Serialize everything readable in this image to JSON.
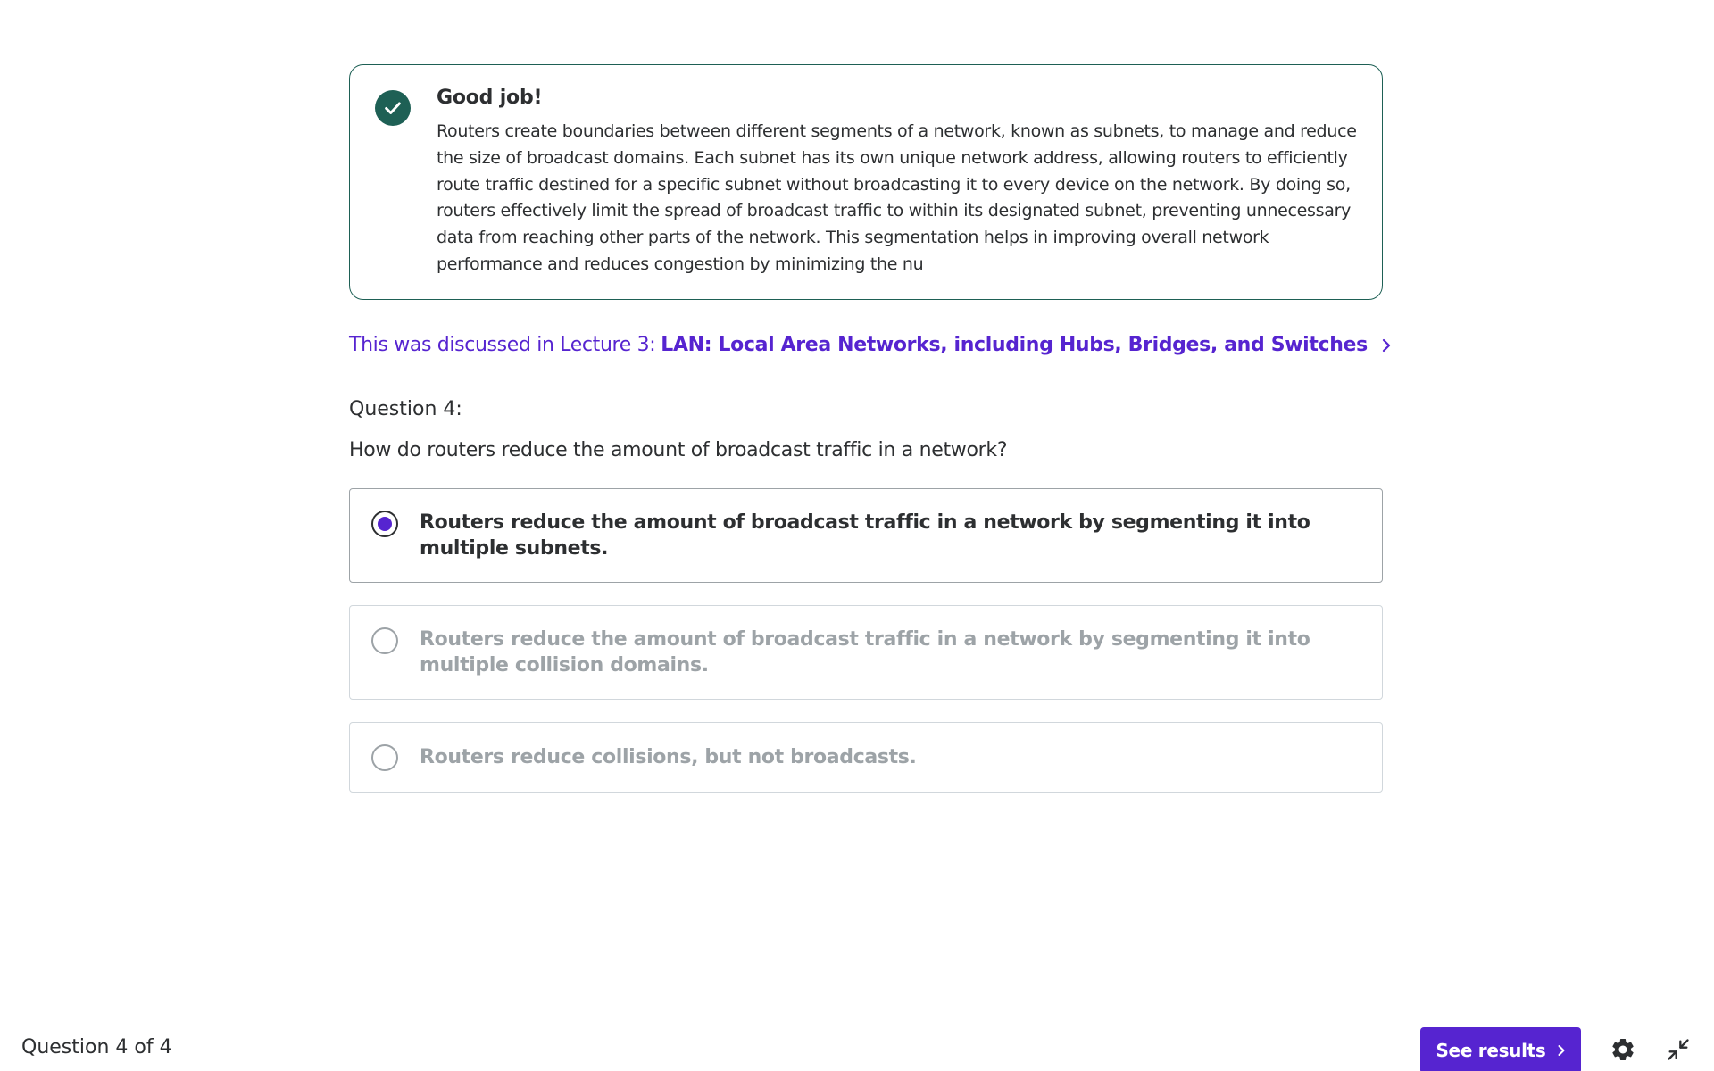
{
  "feedback": {
    "title": "Good job!",
    "body": "Routers create boundaries between different segments of a network, known as subnets, to manage and reduce the size of broadcast domains. Each subnet has its own unique network address, allowing routers to efficiently route traffic destined for a specific subnet without broadcasting it to every device on the network. By doing so, routers effectively limit the spread of broadcast traffic to within its designated subnet, preventing unnecessary data from reaching other parts of the network. This segmentation helps in improving overall network performance and reduces congestion by minimizing the nu",
    "icon": "check-circle-icon",
    "color": "#1e6055"
  },
  "lecture": {
    "prefix": "This was discussed in Lecture 3:",
    "link_text": "LAN: Local Area Networks, including Hubs, Bridges, and Switches",
    "icon": "chevron-right-icon",
    "color": "#5624d0"
  },
  "question": {
    "label": "Question 4:",
    "text": "How do routers reduce the amount of broadcast traffic in a network?"
  },
  "options": [
    {
      "text": "Routers reduce the amount of broadcast traffic in a network by segmenting it into multiple subnets.",
      "selected": true
    },
    {
      "text": "Routers reduce the amount of broadcast traffic in a network by segmenting it into multiple collision domains.",
      "selected": false
    },
    {
      "text": "Routers reduce collisions, but not broadcasts.",
      "selected": false
    }
  ],
  "footer": {
    "progress": "Question 4 of 4",
    "see_results_label": "See results",
    "settings_icon": "gear-icon",
    "collapse_icon": "collapse-icon"
  },
  "colors": {
    "accent": "#5624d0",
    "success": "#1e6055",
    "text": "#2d2f31",
    "muted": "#9da3a7"
  }
}
